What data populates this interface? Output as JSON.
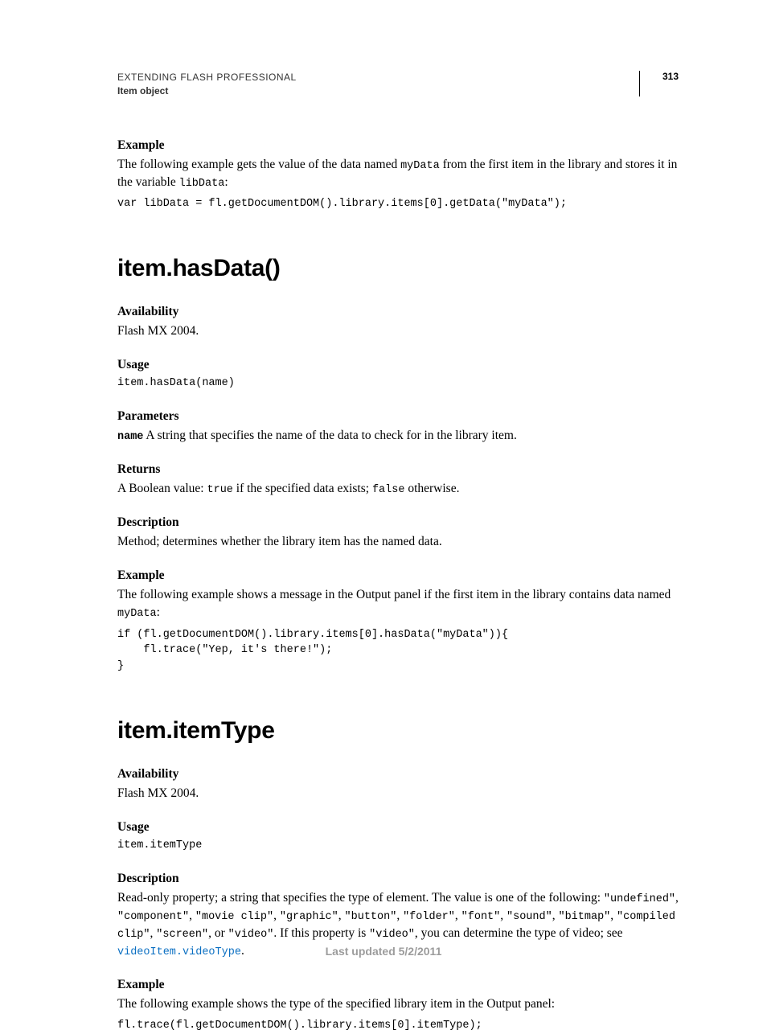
{
  "header": {
    "title": "EXTENDING FLASH PROFESSIONAL",
    "subtitle": "Item object",
    "page_number": "313"
  },
  "section1": {
    "label": "Example",
    "intro_1": "The following example gets the value of the data named ",
    "intro_code1": "myData",
    "intro_2": " from the first item in the library and stores it in the variable ",
    "intro_code2": "libData",
    "intro_3": ":",
    "code": "var libData = fl.getDocumentDOM().library.items[0].getData(\"myData\");"
  },
  "api1": {
    "heading": "item.hasData()",
    "availability_label": "Availability",
    "availability_text": "Flash MX 2004.",
    "usage_label": "Usage",
    "usage_code": "item.hasData(name)",
    "parameters_label": "Parameters",
    "param_name": "name",
    "param_desc": "  A string that specifies the name of the data to check for in the library item.",
    "returns_label": "Returns",
    "returns_1": "A Boolean value: ",
    "returns_code1": "true",
    "returns_2": " if the specified data exists; ",
    "returns_code2": "false",
    "returns_3": " otherwise.",
    "description_label": "Description",
    "description_text": "Method; determines whether the library item has the named data.",
    "example_label": "Example",
    "example_intro_1": "The following example shows a message in the Output panel if the first item in the library contains data named ",
    "example_intro_code": "myData",
    "example_intro_2": ":",
    "example_code": "if (fl.getDocumentDOM().library.items[0].hasData(\"myData\")){\n    fl.trace(\"Yep, it's there!\");\n}"
  },
  "api2": {
    "heading": "item.itemType",
    "availability_label": "Availability",
    "availability_text": "Flash MX 2004.",
    "usage_label": "Usage",
    "usage_code": "item.itemType",
    "description_label": "Description",
    "desc_1": "Read-only property; a string that specifies the type of element. The value is one of the following: ",
    "desc_c1": "\"undefined\"",
    "desc_sep": ", ",
    "desc_c2": "\"component\"",
    "desc_c3": "\"movie clip\"",
    "desc_c4": "\"graphic\"",
    "desc_c5": "\"button\"",
    "desc_c6": "\"folder\"",
    "desc_c7": "\"font\"",
    "desc_c8": "\"sound\"",
    "desc_c9": "\"bitmap\"",
    "desc_c10": "\"compiled clip\"",
    "desc_c11": "\"screen\"",
    "desc_or": ", or ",
    "desc_c12": "\"video\"",
    "desc_2": ". If this property is ",
    "desc_c13": "\"video\"",
    "desc_3": ", you can determine the type of video; see ",
    "desc_link": "videoItem.videoType",
    "desc_4": ".",
    "example_label": "Example",
    "example_intro": "The following example shows the type of the specified library item in the Output panel:",
    "example_code": "fl.trace(fl.getDocumentDOM().library.items[0].itemType);"
  },
  "footer": "Last updated 5/2/2011"
}
